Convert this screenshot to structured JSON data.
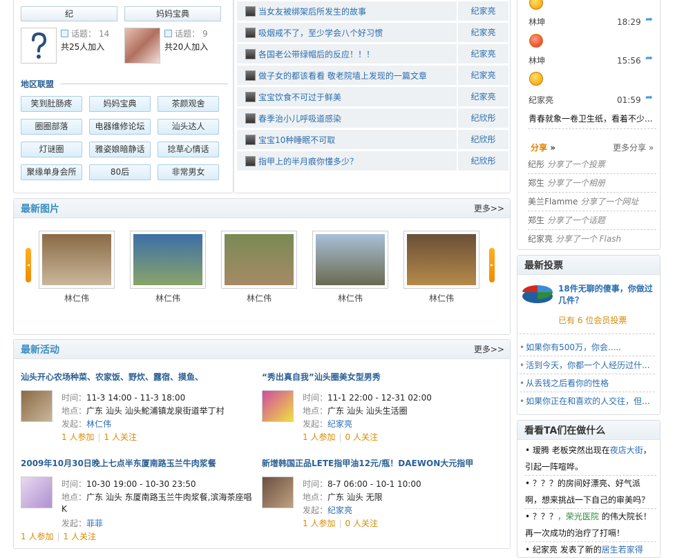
{
  "groups": [
    {
      "name": "纪",
      "topics_label": "话题：",
      "topics": "14",
      "members": "共25人加入"
    },
    {
      "name": "妈妈宝典",
      "topics_label": "话题：",
      "topics": "9",
      "members": "共20人加入"
    }
  ],
  "region": {
    "title": "地区联盟",
    "buttons": [
      "笑到肚肠疼",
      "妈妈宝典",
      "茶颜观舍",
      "圈圈部落",
      "电器维修论坛",
      "汕头达人",
      "灯谜圈",
      "雅姿娘暗静话",
      "捻草心情话",
      "聚缘单身会所",
      "80后",
      "非常男女"
    ]
  },
  "articles": [
    {
      "title": "当女友被绑架后所发生的故事",
      "author": "纪家亮"
    },
    {
      "title": "吸烟戒不了，至少学会八个好习惯",
      "author": "纪家亮"
    },
    {
      "title": "各国老公带绿帽后的反应！！！",
      "author": "纪家亮"
    },
    {
      "title": "做子女的都该看看 敬老院墙上发现的一篇文章",
      "author": "纪家亮"
    },
    {
      "title": "宝宝饮食不可过于鲜美",
      "author": "纪家亮"
    },
    {
      "title": "春季治小儿呼吸道感染",
      "author": "纪欣彤"
    },
    {
      "title": "宝宝10种睡眠不可取",
      "author": "纪欣彤"
    },
    {
      "title": "指甲上的半月痕你懂多少？",
      "author": "纪欣彤"
    }
  ],
  "photos": {
    "title": "最新图片",
    "more": "更多>>",
    "items": [
      {
        "author": "林仁伟",
        "colors": [
          "#8a6a45",
          "#c9b79b"
        ]
      },
      {
        "author": "林仁伟",
        "colors": [
          "#3c6fa8",
          "#8aa46a"
        ]
      },
      {
        "author": "林仁伟",
        "colors": [
          "#7a8a55",
          "#a58a66"
        ]
      },
      {
        "author": "林仁伟",
        "colors": [
          "#a9c0d8",
          "#6a6a50"
        ]
      },
      {
        "author": "林仁伟",
        "colors": [
          "#6a5038",
          "#b58a4a"
        ]
      }
    ]
  },
  "activities": {
    "title": "最新活动",
    "more": "更多>>",
    "items": [
      {
        "title": "汕头开心农场种菜、农家饭、野炊、露宿、摸鱼、",
        "time_label": "时间：",
        "time": "11-3 14:00 - 11-3 18:00",
        "place_label": "地点：",
        "place": "广东  汕头  汕头鮀浦镇龙泉街道举丁村",
        "place2": "",
        "host_label": "发起：",
        "host": "林仁伟",
        "join": "1 人参加",
        "follow": "1 人关注",
        "img": [
          "#8a6a45",
          "#c9b79b"
        ]
      },
      {
        "title": "“秀出真自我”汕头圈美女型男秀",
        "time_label": "时间：",
        "time": "11-1 22:00 - 12-31 02:00",
        "place_label": "地点：",
        "place": "广东  汕头  汕头生活圈",
        "place2": "",
        "host_label": "发起：",
        "host": "纪家亮",
        "join": "1 人参加",
        "follow": "0 人关注",
        "img": [
          "#d04aa0",
          "#f0e040"
        ]
      },
      {
        "title": "2009年10月30日晚上七点半东厦南路玉兰牛肉浆餐",
        "time_label": "时间：",
        "time": "10-30 19:00 - 10-30 23:50",
        "place_label": "地点：",
        "place": "广东  汕头  东厦南路玉兰牛肉浆餐,滨海茶座唱",
        "place2": "K",
        "host_label": "发起：",
        "host": "菲菲",
        "join": "1 人参加",
        "follow": "1 人关注",
        "img": [
          "#e8d8f0",
          "#b090d0"
        ]
      },
      {
        "title": "新增韩国正品LETE指甲油12元/瓶！DAEWON大元指甲",
        "time_label": "时间：",
        "time": "8-7 06:00 - 10-1 10:00",
        "place_label": "地点：",
        "place": "广东  汕头  无限",
        "place2": "",
        "host_label": "发起：",
        "host": "纪家亮",
        "join": "1 人参加",
        "follow": "0 人关注",
        "img": [
          "#6a5040",
          "#c0a080"
        ]
      }
    ]
  },
  "chat": [
    {
      "name": "林坤",
      "time": "18:29"
    },
    {
      "name": "林坤",
      "time": "15:56"
    },
    {
      "name": "纪家亮",
      "time": "01:59"
    }
  ],
  "chat_message": "青春就象一卷卫生纸，看着不少...",
  "share": {
    "title": "分享",
    "arrow": "»",
    "more": "更多分享 »",
    "rows": [
      {
        "user": "纪彤",
        "action": "分享了一个投票"
      },
      {
        "user": "郑生",
        "action": "分享了一个相册"
      },
      {
        "user": "美兰Flamme",
        "action": "分享了一个网址"
      },
      {
        "user": "郑生",
        "action": "分享了一个话题"
      },
      {
        "user": "纪家亮",
        "action": "分享了一个 Flash"
      }
    ]
  },
  "poll": {
    "title": "最新投票",
    "featured": "18件无聊的傻事，你做过几件？",
    "stat_pre": "已有",
    "stat_num": "6",
    "stat_post": "位会员投票",
    "items": [
      "如果你有500万，你会.....",
      "活到今天，你都一个人经历过什...",
      "从丢钱之后看你的性格",
      "如果你正在和喜欢的人交往，但..."
    ]
  },
  "dynamics": {
    "title": "看看TA们在做什么",
    "items": [
      {
        "a": "• 瑷腾",
        "b": " 老板突然出现在",
        "c": "夜店大街",
        "d": "，引起一阵喧哗。"
      },
      {
        "a": "• ？？？",
        "b": "的房间好漂亮、好气派啊，想来挑战一下自己的审美吗？",
        "c": "",
        "d": ""
      },
      {
        "a": "• ？？？",
        "b": "，荣光医院",
        "c": "",
        "d": " 的伟大院长！再一次成功的治疗了打嗝！"
      },
      {
        "a": "• 纪家亮",
        "b": " 发表了新的",
        "c": "居生若家得",
        "d": ""
      }
    ]
  }
}
